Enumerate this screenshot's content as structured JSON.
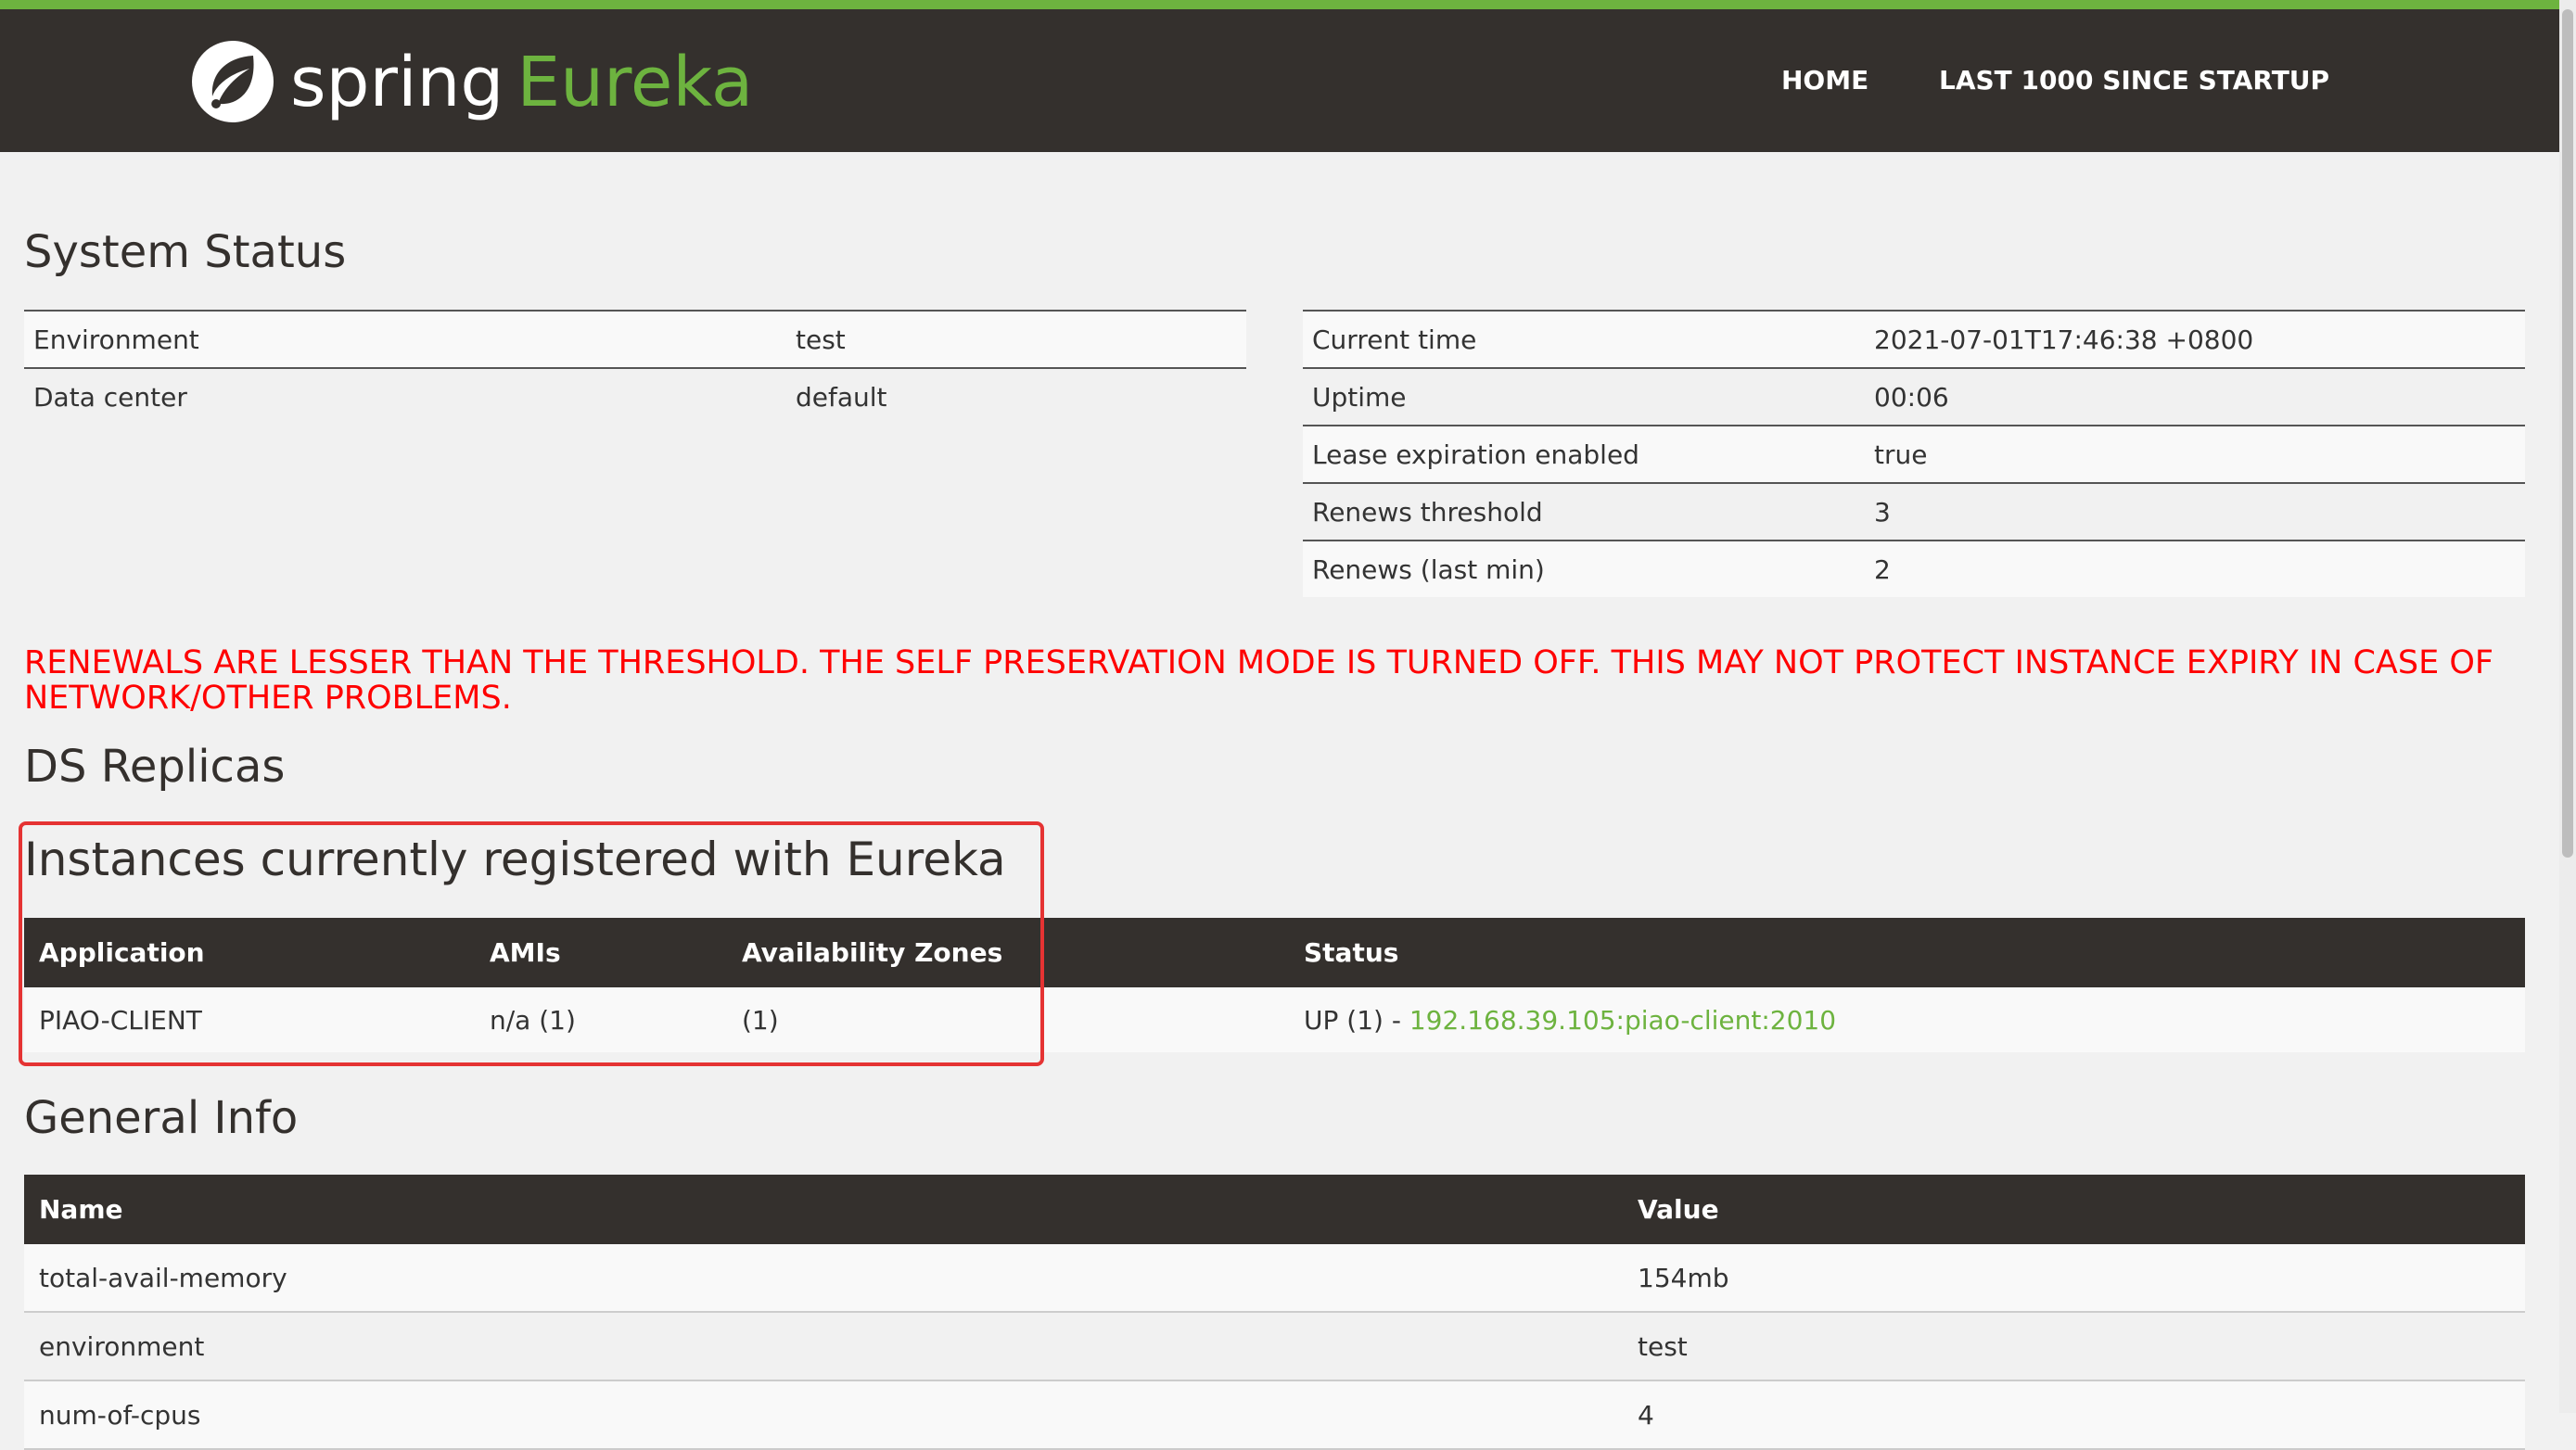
{
  "header": {
    "logo_spring": "spring",
    "logo_eureka": "Eureka",
    "nav": [
      {
        "label": "HOME"
      },
      {
        "label": "LAST 1000 SINCE STARTUP"
      }
    ]
  },
  "colors": {
    "brand_green": "#6db33f",
    "navbar_bg": "#34302d",
    "warning_red": "#ff0000",
    "highlight_red": "#e53333"
  },
  "system_status": {
    "title": "System Status",
    "left": [
      {
        "label": "Environment",
        "value": "test"
      },
      {
        "label": "Data center",
        "value": "default"
      }
    ],
    "right": [
      {
        "label": "Current time",
        "value": "2021-07-01T17:46:38 +0800"
      },
      {
        "label": "Uptime",
        "value": "00:06"
      },
      {
        "label": "Lease expiration enabled",
        "value": "true"
      },
      {
        "label": "Renews threshold",
        "value": "3"
      },
      {
        "label": "Renews (last min)",
        "value": "2"
      }
    ]
  },
  "warning": "RENEWALS ARE LESSER THAN THE THRESHOLD. THE SELF PRESERVATION MODE IS TURNED OFF. THIS MAY NOT PROTECT INSTANCE EXPIRY IN CASE OF NETWORK/OTHER PROBLEMS.",
  "ds_replicas": {
    "title": "DS Replicas"
  },
  "instances": {
    "title": "Instances currently registered with Eureka",
    "columns": [
      "Application",
      "AMIs",
      "Availability Zones",
      "Status"
    ],
    "rows": [
      {
        "application": "PIAO-CLIENT",
        "amis": "n/a (1)",
        "zones": "(1)",
        "status_prefix": "UP (1) - ",
        "status_link": "192.168.39.105:piao-client:2010"
      }
    ]
  },
  "general_info": {
    "title": "General Info",
    "columns": [
      "Name",
      "Value"
    ],
    "rows": [
      {
        "name": "total-avail-memory",
        "value": "154mb"
      },
      {
        "name": "environment",
        "value": "test"
      },
      {
        "name": "num-of-cpus",
        "value": "4"
      }
    ]
  }
}
